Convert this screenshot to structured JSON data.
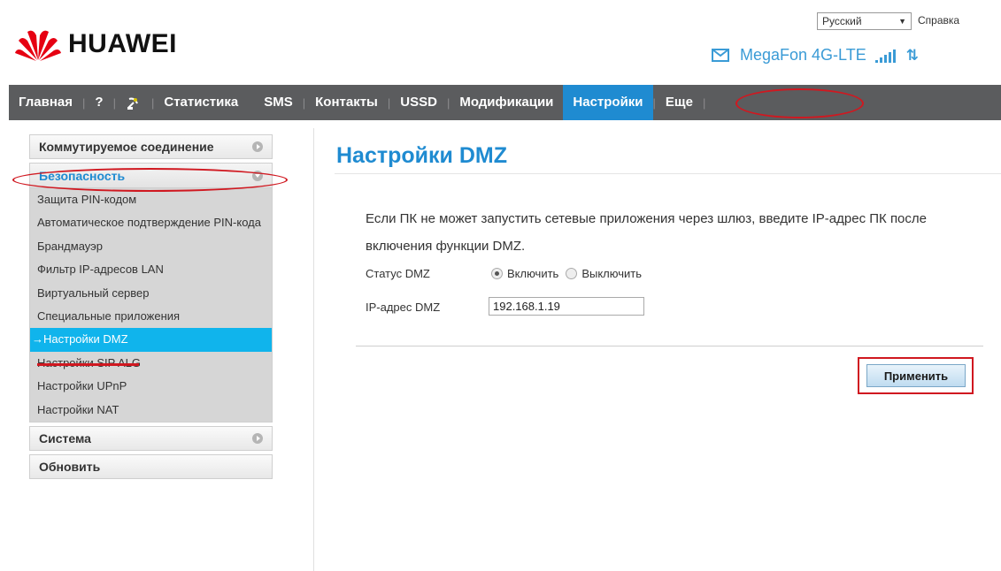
{
  "brand": {
    "name": "HUAWEI",
    "logo_color": "#e60012"
  },
  "header": {
    "language": "Русский",
    "help": "Справка",
    "operator": "MegaFon 4G-LTE",
    "accent": "#3a9bd6"
  },
  "nav": {
    "items": [
      {
        "label": "Главная"
      },
      {
        "label": "?"
      },
      {
        "label": ""
      },
      {
        "label": "Статистика"
      },
      {
        "label": "SMS"
      },
      {
        "label": "Контакты"
      },
      {
        "label": "USSD"
      },
      {
        "label": "Модификации"
      },
      {
        "label": "Настройки",
        "active": true
      },
      {
        "label": "Еще"
      }
    ],
    "bar_color": "#5b5c5e",
    "active_color": "#1f8bd1"
  },
  "sidebar": {
    "sections": [
      {
        "label": "Коммутируемое соединение"
      },
      {
        "label": "Безопасность",
        "expanded": true
      },
      {
        "label": "Система"
      },
      {
        "label": "Обновить"
      }
    ],
    "security_items": [
      "Защита PIN-кодом",
      "Автоматическое подтверждение PIN-кода",
      "Брандмауэр",
      "Фильтр IP-адресов LAN",
      "Виртуальный сервер",
      "Специальные приложения",
      "Настройки DMZ",
      "Настройки SIP ALG",
      "Настройки UPnP",
      "Настройки NAT"
    ],
    "current_marker": "→",
    "current_color": "#10b4ec"
  },
  "main": {
    "title": "Настройки DMZ",
    "description": "Если ПК не может запустить сетевые приложения через шлюз, введите IP-адрес ПК после включения функции DMZ.",
    "status_label": "Статус DMZ",
    "enable_label": "Включить",
    "disable_label": "Выключить",
    "status_value": "Включить",
    "ip_label": "IP-адрес DMZ",
    "ip_value": "192.168.1.19",
    "apply_label": "Применить"
  },
  "annotation_color": "#d01820"
}
